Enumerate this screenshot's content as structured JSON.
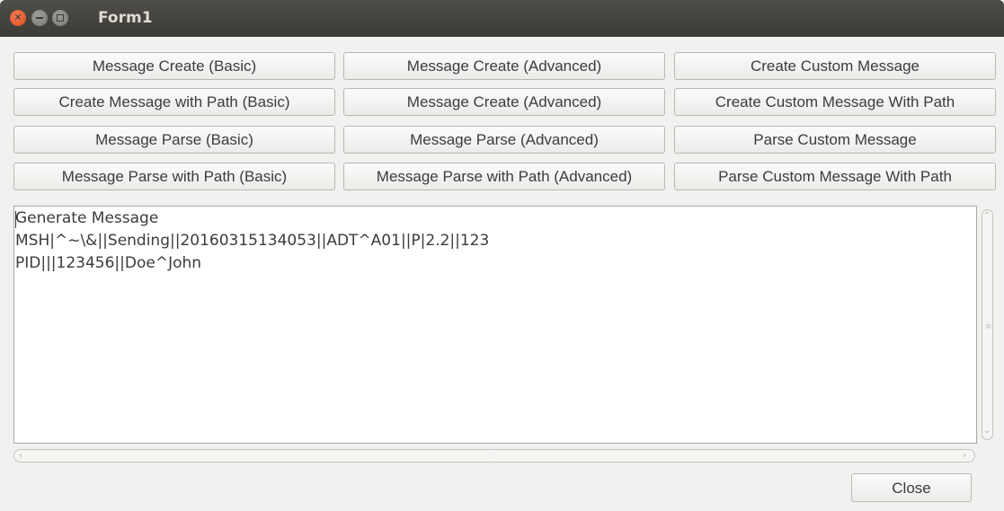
{
  "window": {
    "title": "Form1"
  },
  "buttons": {
    "row1": [
      "Message Create (Basic)",
      "Message Create (Advanced)",
      "Create Custom Message"
    ],
    "row2": [
      "Create Message with Path (Basic)",
      "Message Create (Advanced)",
      "Create Custom Message With Path"
    ],
    "row3": [
      "Message Parse (Basic)",
      "Message Parse (Advanced)",
      "Parse Custom Message"
    ],
    "row4": [
      "Message Parse with Path (Basic)",
      "Message Parse with Path (Advanced)",
      "Parse Custom Message With Path"
    ],
    "close_label": "Close"
  },
  "output": {
    "lines": [
      "Generate Message",
      "MSH|^~\\&||Sending||20160315134053||ADT^A01||P|2.2||123",
      "PID|||123456||Doe^John"
    ]
  },
  "icons": {
    "window_close": "close-icon",
    "window_minimize": "minimize-icon",
    "window_maximize": "maximize-icon",
    "scroll_up": "arrow-up-icon",
    "scroll_down": "arrow-down-icon",
    "scroll_left": "arrow-left-icon",
    "scroll_right": "arrow-right-icon"
  }
}
